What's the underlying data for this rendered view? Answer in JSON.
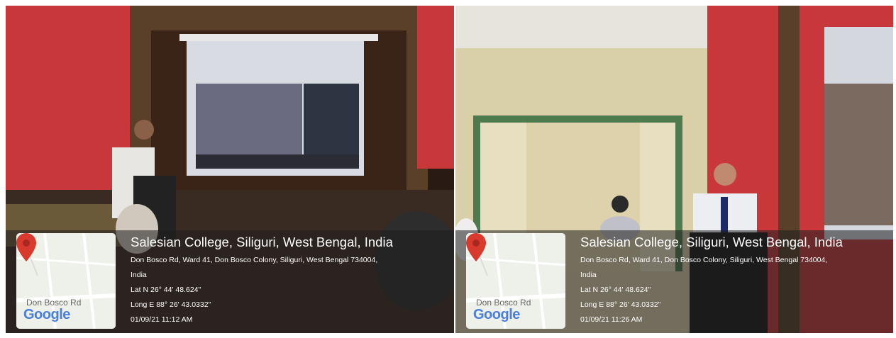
{
  "photos": [
    {
      "location_title": "Salesian College, Siliguri, West Bengal, India",
      "address_line1": "Don Bosco Rd, Ward 41, Don Bosco Colony, Siliguri, West Bengal 734004,",
      "address_line2": "India",
      "latitude": "Lat N 26° 44' 48.624\"",
      "longitude": "Long E 88° 26' 43.0332\"",
      "timestamp": "01/09/21 11:12 AM",
      "map": {
        "road_label": "Don Bosco Rd",
        "logo": "Google",
        "pin_icon": "map-pin-icon"
      }
    },
    {
      "location_title": "Salesian College, Siliguri, West Bengal, India",
      "address_line1": "Don Bosco Rd, Ward 41, Don Bosco Colony, Siliguri, West Bengal 734004,",
      "address_line2": "India",
      "latitude": "Lat N 26° 44' 48.624\"",
      "longitude": "Long E 88° 26' 43.0332\"",
      "timestamp": "01/09/21 11:26 AM",
      "map": {
        "road_label": "Don Bosco Rd",
        "logo": "Google",
        "pin_icon": "map-pin-icon"
      }
    }
  ],
  "colors": {
    "wall_red": "#c8383a",
    "stone_border": "#5a4028",
    "overlay": "#2a2a2a",
    "pin_red": "#d93a2e",
    "map_background": "#eef0ea"
  }
}
